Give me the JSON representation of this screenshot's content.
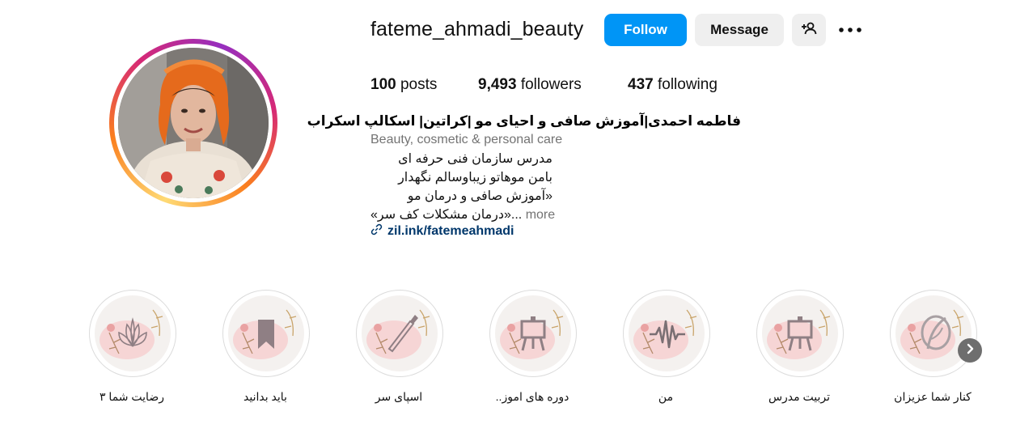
{
  "profile": {
    "username": "fateme_ahmadi_beauty",
    "follow_label": "Follow",
    "message_label": "Message",
    "add_user_icon": "add-user-icon",
    "more_icon": "more-horizontal-icon",
    "posts_count": "100",
    "posts_label": "posts",
    "followers_count": "9,493",
    "followers_label": "followers",
    "following_count": "437",
    "following_label": "following"
  },
  "bio": {
    "name": "فاطمه احمدی|آموزش صافی و احیای مو |کراتین| اسکالپ اسکراب",
    "category": "Beauty, cosmetic & personal care",
    "line1": "مدرس سازمان فنی حرفه ای",
    "line2": "بامن موهاتو زیباوسالم نگهدار",
    "line3": "«آموزش صافی و درمان مو",
    "line4": "«درمان مشکلات کف سر»",
    "ellipsis": "...",
    "more_label": "more",
    "link_icon": "link-icon",
    "link_text": "zil.ink/fatemeahmadi"
  },
  "highlights": [
    {
      "label": "رضایت شما ۳",
      "icon": "lotus-icon"
    },
    {
      "label": "باید بدانید",
      "icon": "bookmark-icon"
    },
    {
      "label": "اسپای سر",
      "icon": "brush-icon"
    },
    {
      "label": "دوره های اموز..",
      "icon": "easel-icon"
    },
    {
      "label": "من",
      "icon": "waveform-icon"
    },
    {
      "label": "تربیت مدرس",
      "icon": "easel-icon"
    },
    {
      "label": "کنار شما عزیزان",
      "icon": "logo-leaf-icon"
    }
  ],
  "colors": {
    "follow_button": "#0095f6",
    "secondary_button": "#efefef",
    "link": "#00376b",
    "muted_text": "#737373"
  }
}
